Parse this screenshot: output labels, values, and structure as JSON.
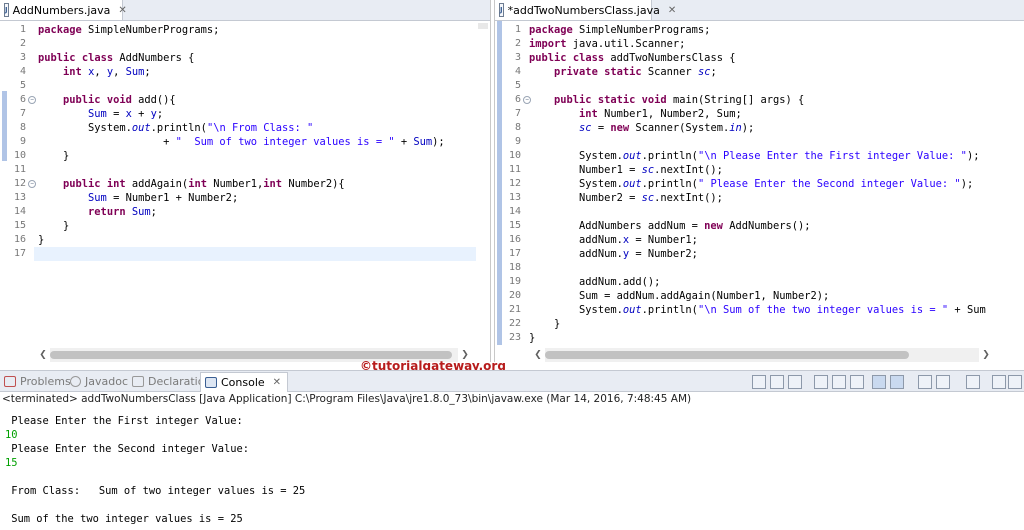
{
  "left_editor": {
    "tab_title": "AddNumbers.java",
    "line_numbers": [
      "1",
      "2",
      "3",
      "4",
      "5",
      "6",
      "7",
      "8",
      "9",
      "10",
      "11",
      "12",
      "13",
      "14",
      "15",
      "16",
      "17"
    ],
    "lines": [
      "package SimpleNumberPrograms;",
      "",
      "public class AddNumbers {",
      "    int x, y, Sum;",
      "",
      "    public void add(){",
      "        Sum = x + y;",
      "        System.out.println(\"\\n From Class: \"",
      "                    + \"  Sum of two integer values is = \" + Sum);",
      "    }",
      "",
      "    public int addAgain(int Number1,int Number2){",
      "        Sum = Number1 + Number2;",
      "        return Sum;",
      "    }",
      "}",
      ""
    ]
  },
  "right_editor": {
    "tab_title": "*addTwoNumbersClass.java",
    "line_numbers": [
      "1",
      "2",
      "3",
      "4",
      "5",
      "6",
      "7",
      "8",
      "9",
      "10",
      "11",
      "12",
      "13",
      "14",
      "15",
      "16",
      "17",
      "18",
      "19",
      "20",
      "21",
      "22",
      "23"
    ],
    "lines": [
      "package SimpleNumberPrograms;",
      "import java.util.Scanner;",
      "public class addTwoNumbersClass {",
      "    private static Scanner sc;",
      "",
      "    public static void main(String[] args) {",
      "        int Number1, Number2, Sum;",
      "        sc = new Scanner(System.in);",
      "",
      "        System.out.println(\"\\n Please Enter the First integer Value: \");",
      "        Number1 = sc.nextInt();",
      "        System.out.println(\" Please Enter the Second integer Value: \");",
      "        Number2 = sc.nextInt();",
      "",
      "        AddNumbers addNum = new AddNumbers();",
      "        addNum.x = Number1;",
      "        addNum.y = Number2;",
      "",
      "        addNum.add();",
      "        Sum = addNum.addAgain(Number1, Number2);",
      "        System.out.println(\"\\n Sum of the two integer values is = \" + Sum",
      "    }",
      "}"
    ]
  },
  "watermark": "©tutorialgateway.org",
  "console": {
    "tabs": [
      {
        "label": "Problems",
        "icon": "problems-icon",
        "active": false
      },
      {
        "label": "Javadoc",
        "icon": "javadoc-icon",
        "active": false
      },
      {
        "label": "Declaration",
        "icon": "declaration-icon",
        "active": false
      },
      {
        "label": "Console",
        "icon": "console-icon",
        "active": true
      }
    ],
    "status": "<terminated> addTwoNumbersClass [Java Application] C:\\Program Files\\Java\\jre1.8.0_73\\bin\\javaw.exe (Mar 14, 2016, 7:48:45 AM)",
    "output": [
      {
        "text": " Please Enter the First integer Value: ",
        "input": false
      },
      {
        "text": "10",
        "input": true
      },
      {
        "text": " Please Enter the Second integer Value: ",
        "input": false
      },
      {
        "text": "15",
        "input": true
      },
      {
        "text": "",
        "input": false
      },
      {
        "text": " From Class:   Sum of two integer values is = 25",
        "input": false
      },
      {
        "text": "",
        "input": false
      },
      {
        "text": " Sum of the two integer values is = 25",
        "input": false
      }
    ]
  },
  "colors": {
    "keyword": "#7f0055",
    "string": "#2a00ff",
    "field": "#0000c0",
    "user_input": "#00a000",
    "watermark": "#b71c1c"
  }
}
